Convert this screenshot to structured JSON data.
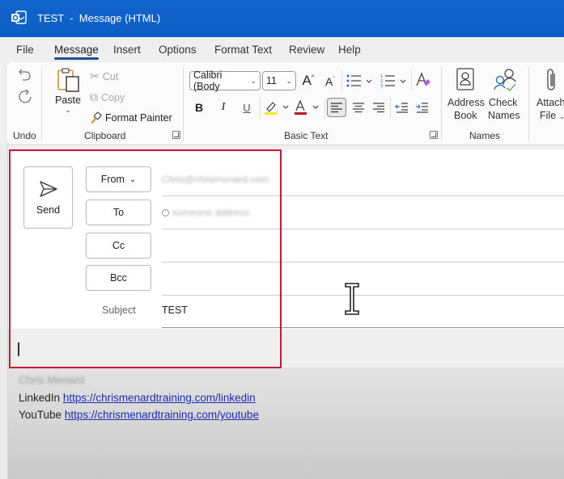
{
  "window": {
    "title": "TEST  -  Message (HTML)",
    "app_icon": "outlook-icon",
    "accent_color": "#0f63c9"
  },
  "tabs": [
    {
      "label": "File",
      "active": false
    },
    {
      "label": "Message",
      "active": true
    },
    {
      "label": "Insert",
      "active": false
    },
    {
      "label": "Options",
      "active": false
    },
    {
      "label": "Format Text",
      "active": false
    },
    {
      "label": "Review",
      "active": false
    },
    {
      "label": "Help",
      "active": false
    }
  ],
  "ribbon": {
    "undo": {
      "group_label": "Undo",
      "undo_icon": "undo-icon",
      "redo_icon": "redo-icon"
    },
    "clipboard": {
      "group_label": "Clipboard",
      "paste_label": "Paste",
      "cut_label": "Cut",
      "copy_label": "Copy",
      "format_painter_label": "Format Painter"
    },
    "basic_text": {
      "group_label": "Basic Text",
      "font_name": "Calibri (Body",
      "font_size": "11",
      "bold": "B",
      "italic": "I",
      "underline": "U",
      "highlight_color": "#f2e829",
      "font_color": "#c0121f"
    },
    "names": {
      "group_label": "Names",
      "address_book_label_1": "Address",
      "address_book_label_2": "Book",
      "check_names_label_1": "Check",
      "check_names_label_2": "Names"
    },
    "include": {
      "attach_label_1": "Attach",
      "attach_label_2": "File"
    }
  },
  "compose": {
    "send_label": "Send",
    "from_label": "From",
    "to_label": "To",
    "cc_label": "Cc",
    "bcc_label": "Bcc",
    "from_value": "Chris@chrismenard.com",
    "to_value": "someone address",
    "cc_value": "",
    "bcc_value": "",
    "subject_label": "Subject",
    "subject_value": "TEST",
    "highlight_color": "#c8193a"
  },
  "signature": {
    "name": "Chris Menard",
    "linkedin_label": "LinkedIn",
    "linkedin_url": "https://chrismenardtraining.com/linkedin",
    "youtube_label": "YouTube",
    "youtube_url": "https://chrismenardtraining.com/youtube"
  }
}
